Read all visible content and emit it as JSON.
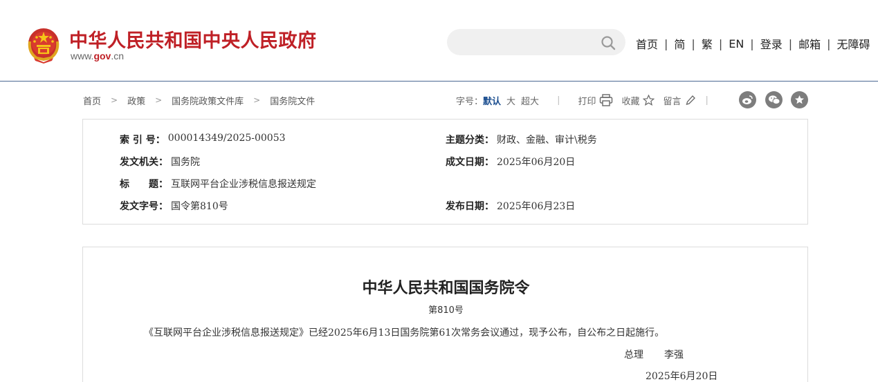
{
  "header": {
    "site_title": "中华人民共和国中央人民政府",
    "site_url_prefix": "www.",
    "site_url_brand": "gov",
    "site_url_suffix": ".cn",
    "search_placeholder": "",
    "nav": [
      "首页",
      "简",
      "繁",
      "EN",
      "登录",
      "邮箱",
      "无障碍"
    ],
    "nav_separator": "|"
  },
  "breadcrumb": {
    "items": [
      "首页",
      "政策",
      "国务院政策文件库",
      "国务院文件"
    ],
    "arrow": ">"
  },
  "tools": {
    "font_label": "字号：",
    "font_default": "默认",
    "font_large": "大",
    "font_xlarge": "超大",
    "print_label": "打印",
    "favorite_label": "收藏",
    "comment_label": "留言",
    "separator": "|"
  },
  "info": {
    "index_label": "索 引 号：",
    "index_value": "000014349/2025-00053",
    "topic_label": "主题分类：",
    "topic_value": "财政、金融、审计\\税务",
    "issuer_label": "发文机关：",
    "issuer_value": "国务院",
    "written_label": "成文日期：",
    "written_value": "2025年06月20日",
    "title_label": "标　　题：",
    "title_value": "互联网平台企业涉税信息报送规定",
    "docno_label": "发文字号：",
    "docno_value": "国令第810号",
    "published_label": "发布日期：",
    "published_value": "2025年06月23日"
  },
  "document": {
    "title": "中华人民共和国国务院令",
    "number": "第810号",
    "body": "《互联网平台企业涉税信息报送规定》已经2025年6月13日国务院第61次常务会议通过，现予公布，自公布之日起施行。",
    "sign_role": "总理",
    "sign_name": "李强",
    "sign_date": "2025年6月20日"
  },
  "colors": {
    "brand_red": "#bf2026",
    "link_blue": "#1a4d8f",
    "header_rule": "#4a6791",
    "share_icon_bg": "#7d7d7d"
  }
}
